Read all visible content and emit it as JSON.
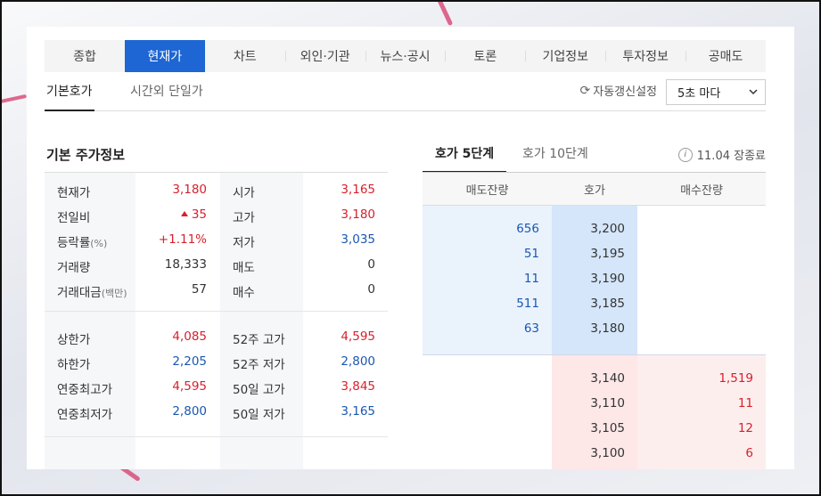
{
  "tabs": [
    "종합",
    "현재가",
    "차트",
    "외인·기관",
    "뉴스·공시",
    "토론",
    "기업정보",
    "투자정보",
    "공매도"
  ],
  "subtabs": [
    "기본호가",
    "시간외 단일가"
  ],
  "refresh_label": "자동갱신설정",
  "interval_select": "5초 마다",
  "section_title": "기본 주가정보",
  "price_info": {
    "block1": [
      {
        "l1": "현재가",
        "v1": "3,180",
        "l2": "시가",
        "v2": "3,165"
      },
      {
        "l1": "전일비",
        "v1": "35",
        "l2": "고가",
        "v2": "3,180"
      },
      {
        "l1": "등락률",
        "u1": "(%)",
        "v1": "+1.11%",
        "l2": "저가",
        "v2": "3,035"
      },
      {
        "l1": "거래량",
        "v1": "18,333",
        "l2": "매도",
        "v2": "0"
      },
      {
        "l1": "거래대금",
        "u1": "(백만)",
        "v1": "57",
        "l2": "매수",
        "v2": "0"
      }
    ],
    "block2": [
      {
        "l1": "상한가",
        "v1": "4,085",
        "l2": "52주 고가",
        "v2": "4,595"
      },
      {
        "l1": "하한가",
        "v1": "2,205",
        "l2": "52주 저가",
        "v2": "2,800"
      },
      {
        "l1": "연중최고가",
        "v1": "4,595",
        "l2": "50일 고가",
        "v2": "3,845"
      },
      {
        "l1": "연중최저가",
        "v1": "2,800",
        "l2": "50일 저가",
        "v2": "3,165"
      }
    ]
  },
  "hoga_tabs": [
    "호가 5단계",
    "호가 10단계"
  ],
  "closed_text": "11.04 장종료",
  "orderbook": {
    "headers": [
      "매도잔량",
      "호가",
      "매수잔량"
    ],
    "asks": [
      {
        "qty": "656",
        "price": "3,200"
      },
      {
        "qty": "51",
        "price": "3,195"
      },
      {
        "qty": "11",
        "price": "3,190"
      },
      {
        "qty": "511",
        "price": "3,185"
      },
      {
        "qty": "63",
        "price": "3,180"
      }
    ],
    "bids": [
      {
        "price": "3,140",
        "qty": "1,519"
      },
      {
        "price": "3,110",
        "qty": "11"
      },
      {
        "price": "3,105",
        "qty": "12"
      },
      {
        "price": "3,100",
        "qty": "6"
      }
    ]
  },
  "colors": {
    "accent": "#1d66d3",
    "up": "#d91f2b",
    "down": "#1a57b2"
  }
}
